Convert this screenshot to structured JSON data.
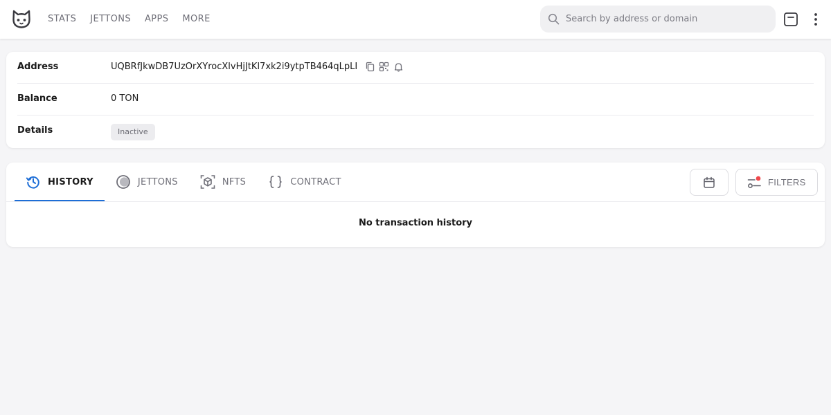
{
  "nav": {
    "items": [
      {
        "label": "STATS"
      },
      {
        "label": "JETTONS"
      },
      {
        "label": "APPS"
      },
      {
        "label": "MORE"
      }
    ]
  },
  "search": {
    "placeholder": "Search by address or domain",
    "value": ""
  },
  "icons": {
    "logo": "cat-logo-icon",
    "search": "search-icon",
    "theme": "square-toggle-icon",
    "more": "more-vertical-icon",
    "copy": "copy-icon",
    "qr": "qr-code-icon",
    "bell": "bell-icon",
    "history": "history-icon",
    "jettons": "coin-icon",
    "nfts": "cube-icon",
    "contract": "braces-icon",
    "calendar": "calendar-icon",
    "filters": "filters-icon"
  },
  "account": {
    "address_label": "Address",
    "address": "UQBRfJkwDB7UzOrXYrocXlvHjJtKl7xk2i9ytpTB464qLpLI",
    "balance_label": "Balance",
    "balance": "0 TON",
    "details_label": "Details",
    "status": "Inactive"
  },
  "tabs": [
    {
      "label": "HISTORY",
      "active": true
    },
    {
      "label": "JETTONS",
      "active": false
    },
    {
      "label": "NFTS",
      "active": false
    },
    {
      "label": "CONTRACT",
      "active": false
    }
  ],
  "filters": {
    "label": "FILTERS",
    "indicator_color": "#f0474b"
  },
  "history": {
    "empty_message": "No transaction history"
  },
  "colors": {
    "accent": "#1e6ed6",
    "background": "#f5f5f7"
  }
}
